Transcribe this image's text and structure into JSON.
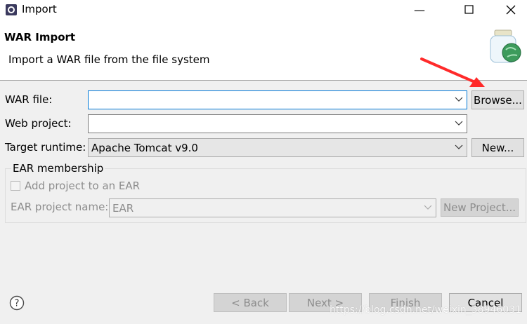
{
  "window": {
    "title": "Import",
    "minimize_glyph": "—",
    "maximize_glyph": "☐",
    "close_glyph": "✕"
  },
  "header": {
    "title": "WAR Import",
    "description": "Import a WAR file from the file system"
  },
  "form": {
    "war_file_label": "WAR file:",
    "war_file_value": "",
    "browse_label": "Browse...",
    "web_project_label": "Web project:",
    "web_project_value": "",
    "target_runtime_label": "Target runtime:",
    "target_runtime_value": "Apache Tomcat v9.0",
    "new_label": "New..."
  },
  "ear": {
    "group_label": "EAR membership",
    "add_project_label": "Add project to an EAR",
    "ear_name_label": "EAR project name:",
    "ear_name_value": "EAR",
    "new_project_label": "New Project..."
  },
  "footer": {
    "back_label": "< Back",
    "next_label": "Next >",
    "finish_label": "Finish",
    "cancel_label": "Cancel",
    "watermark": "https://blog.csdn.net/weixin_38946031"
  },
  "colors": {
    "focus_border": "#0078d7",
    "annotation_arrow": "#ff2a2a"
  }
}
